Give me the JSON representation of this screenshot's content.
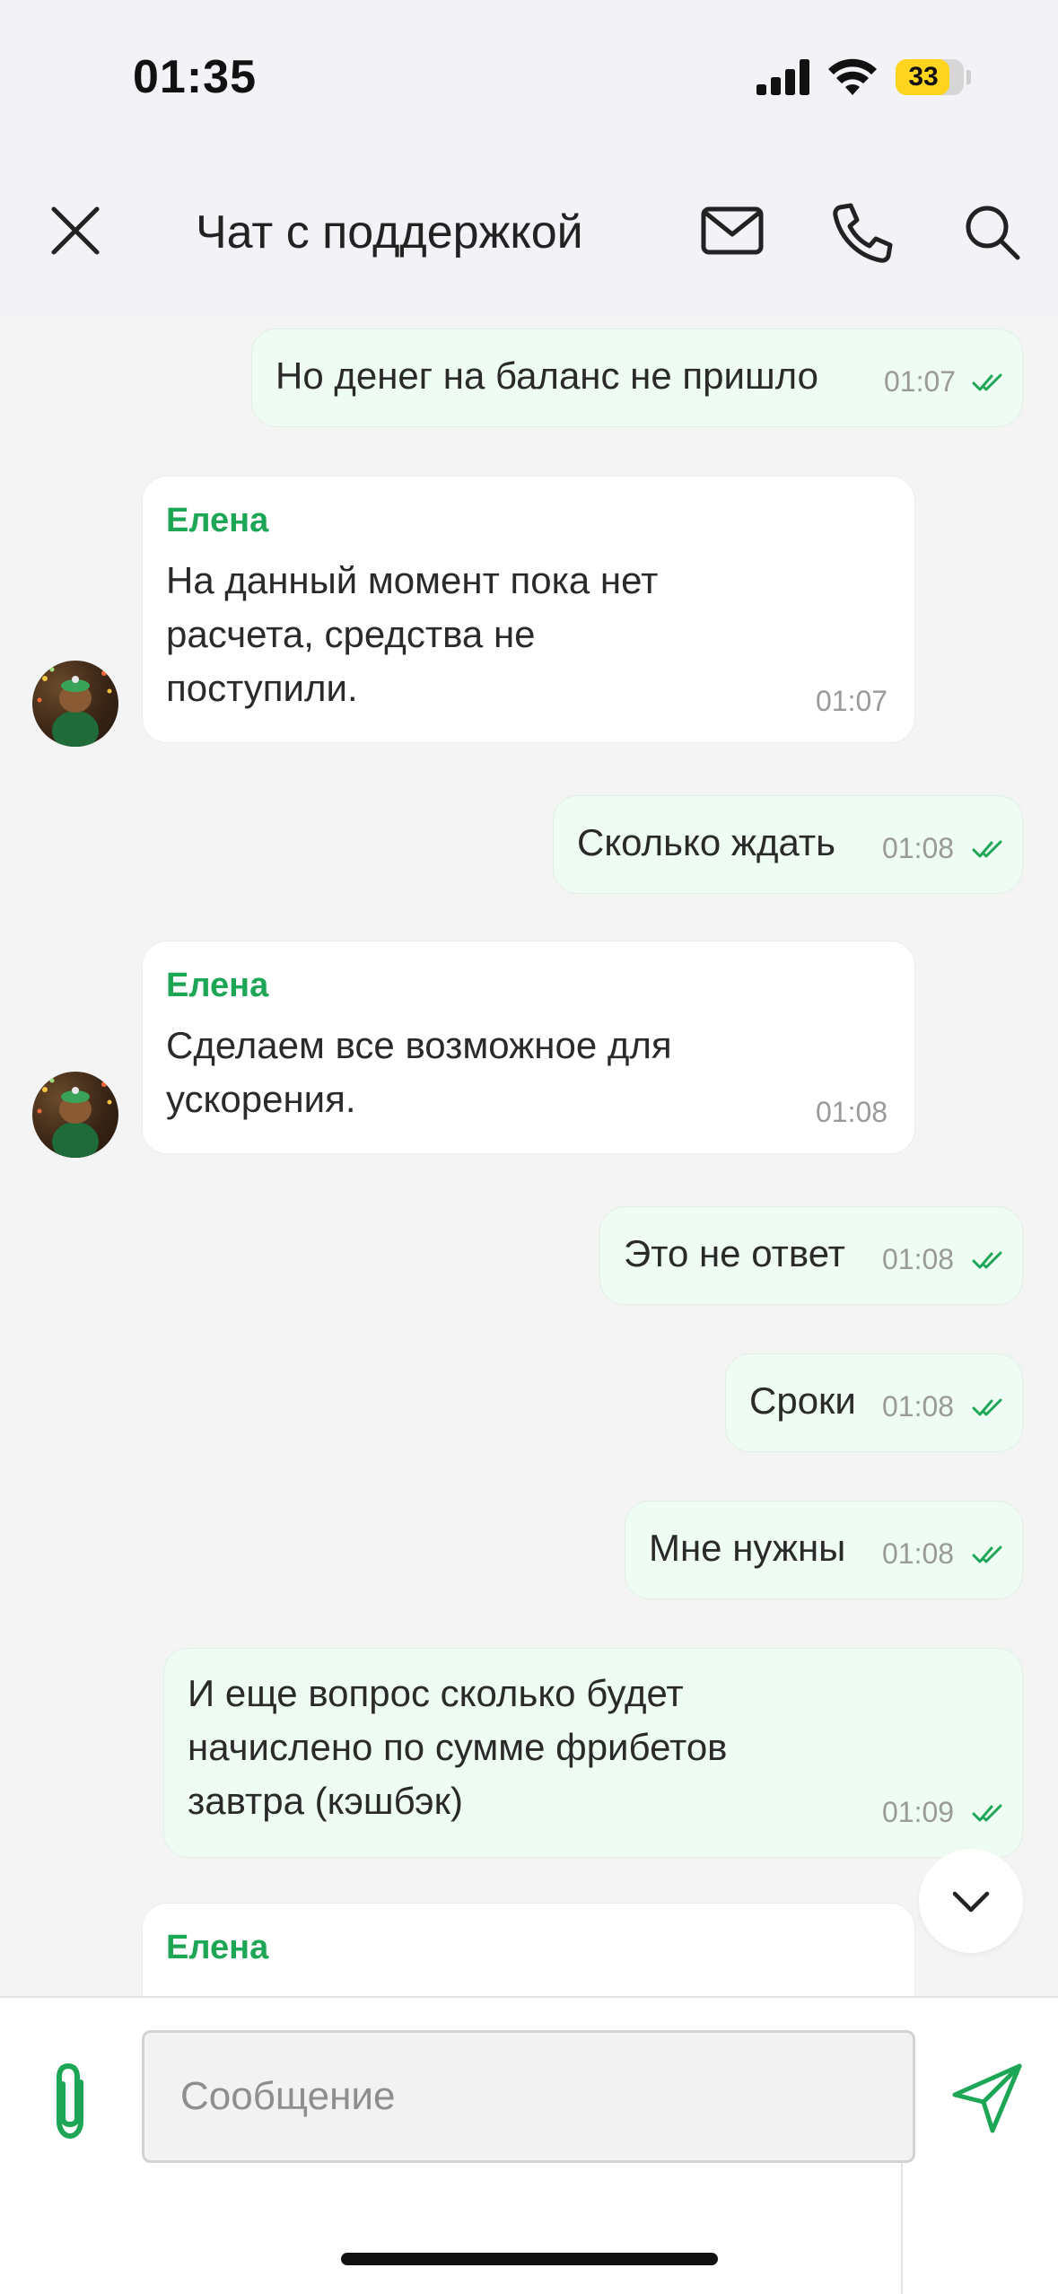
{
  "status_bar": {
    "time": "01:35",
    "battery_level": "33",
    "battery_fraction": 0.33
  },
  "header": {
    "title": "Чат с поддержкой",
    "icons": [
      "close-icon",
      "mail-icon",
      "phone-icon",
      "search-icon"
    ]
  },
  "colors": {
    "accent_green": "#1ea657",
    "outgoing_bubble": "#effcf3",
    "incoming_bubble": "#ffffff",
    "background": "#f4f4f4",
    "battery_yellow": "#ffd41f"
  },
  "messages": [
    {
      "direction": "out",
      "text": "Но денег на баланс не пришло",
      "time": "01:07",
      "read": true
    },
    {
      "direction": "in",
      "sender": "Елена",
      "text": "На данный момент пока нет\nрасчета, средства не\nпоступили.",
      "time": "01:07"
    },
    {
      "direction": "out",
      "text": "Сколько ждать",
      "time": "01:08",
      "read": true
    },
    {
      "direction": "in",
      "sender": "Елена",
      "text": "Сделаем все возможное для\nускорения.",
      "time": "01:08"
    },
    {
      "direction": "out",
      "text": "Это не ответ",
      "time": "01:08",
      "read": true
    },
    {
      "direction": "out",
      "text": "Сроки",
      "time": "01:08",
      "read": true
    },
    {
      "direction": "out",
      "text": "Мне нужны",
      "time": "01:08",
      "read": true
    },
    {
      "direction": "out",
      "text": "И еще вопрос сколько будет\nначислено по сумме фрибетов\nзавтра (кэшбэк)",
      "time": "01:09",
      "read": true
    },
    {
      "direction": "in",
      "sender": "Елена",
      "partial": true
    }
  ],
  "composer": {
    "placeholder": "Сообщение",
    "value": ""
  }
}
